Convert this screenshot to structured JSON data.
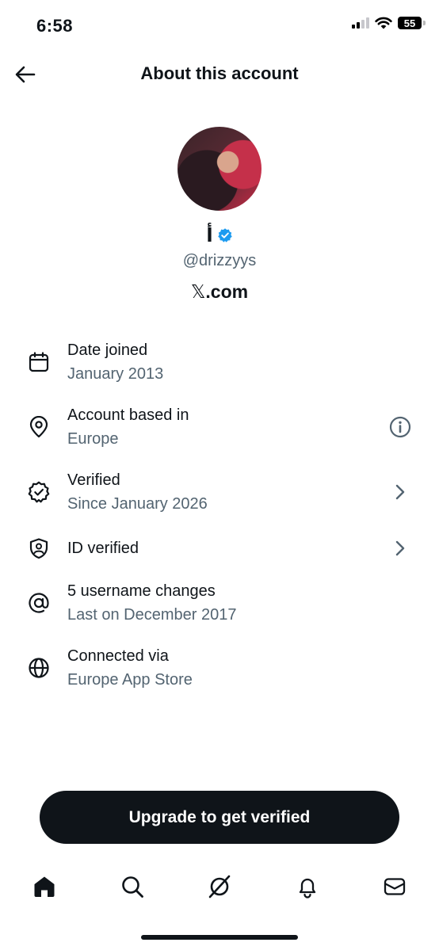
{
  "status_bar": {
    "time": "6:58",
    "battery": "55"
  },
  "header": {
    "title": "About this account"
  },
  "profile": {
    "display_name": "أ",
    "handle": "@drizzyys",
    "site_mark": "𝕏",
    "site_suffix": ".com"
  },
  "details": [
    {
      "primary": "Date joined",
      "secondary": "January 2013",
      "icon": "calendar-icon"
    },
    {
      "primary": "Account based in",
      "secondary": "Europe",
      "icon": "location-pin-icon",
      "trail": "info-icon"
    },
    {
      "primary": "Verified",
      "secondary": "Since January 2026",
      "icon": "verified-badge-icon",
      "trail": "chevron-right-icon"
    },
    {
      "primary": "ID verified",
      "icon": "id-shield-icon",
      "trail": "chevron-right-icon"
    },
    {
      "primary": "5 username changes",
      "secondary": "Last on December 2017",
      "icon": "at-sign-icon"
    },
    {
      "primary": "Connected via",
      "secondary": "Europe App Store",
      "icon": "globe-icon"
    }
  ],
  "cta": {
    "label": "Upgrade to get verified"
  },
  "bottom_nav": [
    "home-icon",
    "search-icon",
    "grok-icon",
    "notifications-bell-icon",
    "messages-envelope-icon"
  ],
  "colors": {
    "text": "#0f1419",
    "secondary": "#536471",
    "verified_blue": "#1d9bf0"
  }
}
